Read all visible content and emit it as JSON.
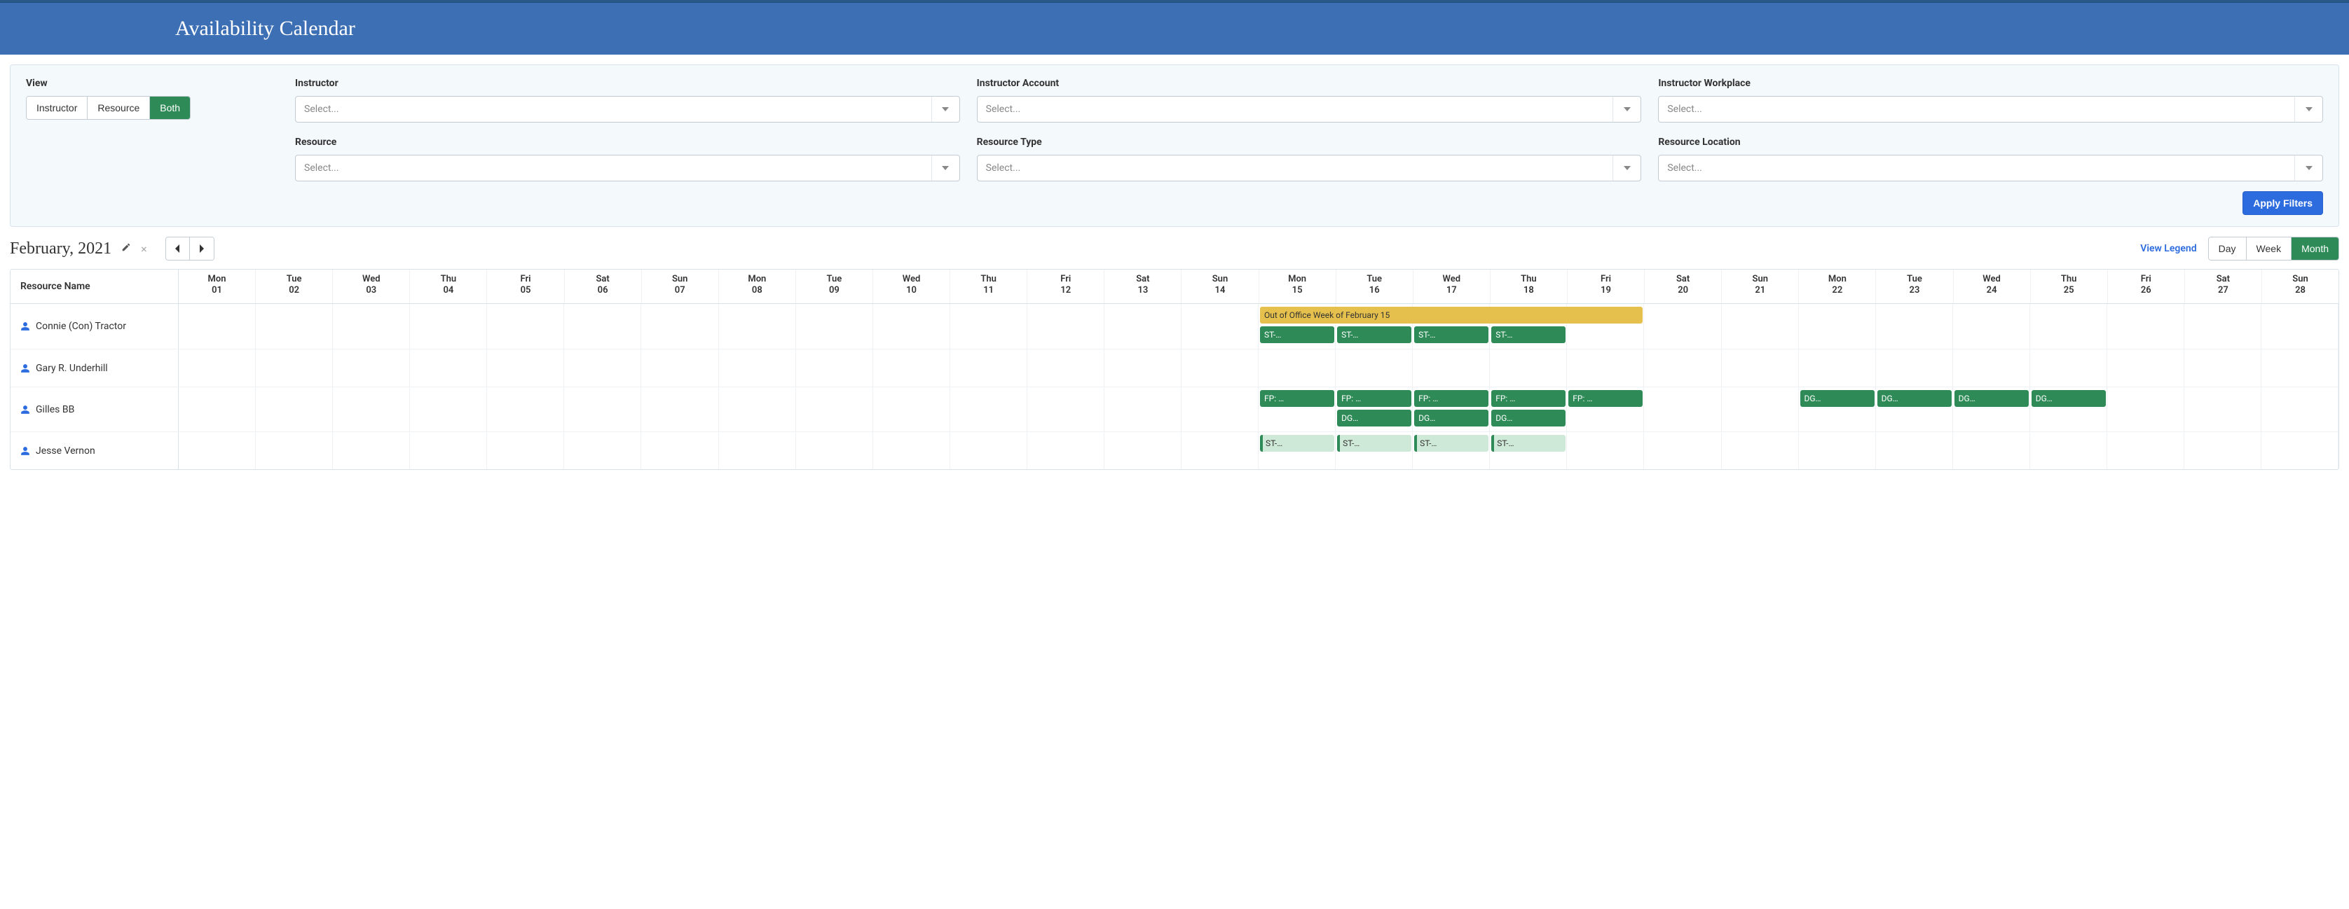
{
  "header": {
    "title": "Availability Calendar"
  },
  "filters": {
    "view_label": "View",
    "view_options": [
      "Instructor",
      "Resource",
      "Both"
    ],
    "view_selected": "Both",
    "selects": [
      {
        "label": "Instructor",
        "value": "Select..."
      },
      {
        "label": "Instructor Account",
        "value": "Select..."
      },
      {
        "label": "Instructor Workplace",
        "value": "Select..."
      },
      {
        "label": "Resource",
        "value": "Select..."
      },
      {
        "label": "Resource Type",
        "value": "Select..."
      },
      {
        "label": "Resource Location",
        "value": "Select..."
      }
    ],
    "apply_label": "Apply Filters"
  },
  "toolbar": {
    "month_title": "February, 2021",
    "view_legend": "View Legend",
    "range_options": [
      "Day",
      "Week",
      "Month"
    ],
    "range_selected": "Month"
  },
  "calendar": {
    "resource_header": "Resource Name",
    "days": [
      {
        "dow": "Mon",
        "num": "01"
      },
      {
        "dow": "Tue",
        "num": "02"
      },
      {
        "dow": "Wed",
        "num": "03"
      },
      {
        "dow": "Thu",
        "num": "04"
      },
      {
        "dow": "Fri",
        "num": "05"
      },
      {
        "dow": "Sat",
        "num": "06"
      },
      {
        "dow": "Sun",
        "num": "07"
      },
      {
        "dow": "Mon",
        "num": "08"
      },
      {
        "dow": "Tue",
        "num": "09"
      },
      {
        "dow": "Wed",
        "num": "10"
      },
      {
        "dow": "Thu",
        "num": "11"
      },
      {
        "dow": "Fri",
        "num": "12"
      },
      {
        "dow": "Sat",
        "num": "13"
      },
      {
        "dow": "Sun",
        "num": "14"
      },
      {
        "dow": "Mon",
        "num": "15"
      },
      {
        "dow": "Tue",
        "num": "16"
      },
      {
        "dow": "Wed",
        "num": "17"
      },
      {
        "dow": "Thu",
        "num": "18"
      },
      {
        "dow": "Fri",
        "num": "19"
      },
      {
        "dow": "Sat",
        "num": "20"
      },
      {
        "dow": "Sun",
        "num": "21"
      },
      {
        "dow": "Mon",
        "num": "22"
      },
      {
        "dow": "Tue",
        "num": "23"
      },
      {
        "dow": "Wed",
        "num": "24"
      },
      {
        "dow": "Thu",
        "num": "25"
      },
      {
        "dow": "Fri",
        "num": "26"
      },
      {
        "dow": "Sat",
        "num": "27"
      },
      {
        "dow": "Sun",
        "num": "28"
      }
    ],
    "resources": [
      {
        "name": "Connie (Con) Tractor",
        "events": [
          {
            "label": "Out of Office Week of February 15",
            "start": 14,
            "span": 5,
            "row": 0,
            "type": "yellow"
          },
          {
            "label": "ST-…",
            "start": 14,
            "span": 1,
            "row": 1,
            "type": "green"
          },
          {
            "label": "ST-…",
            "start": 15,
            "span": 1,
            "row": 1,
            "type": "green"
          },
          {
            "label": "ST-…",
            "start": 16,
            "span": 1,
            "row": 1,
            "type": "green"
          },
          {
            "label": "ST-…",
            "start": 17,
            "span": 1,
            "row": 1,
            "type": "green"
          }
        ]
      },
      {
        "name": "Gary R. Underhill",
        "events": []
      },
      {
        "name": "Gilles BB",
        "events": [
          {
            "label": "FP: …",
            "start": 14,
            "span": 1,
            "row": 0,
            "type": "green"
          },
          {
            "label": "FP: …",
            "start": 15,
            "span": 1,
            "row": 0,
            "type": "green"
          },
          {
            "label": "FP: …",
            "start": 16,
            "span": 1,
            "row": 0,
            "type": "green"
          },
          {
            "label": "FP: …",
            "start": 17,
            "span": 1,
            "row": 0,
            "type": "green"
          },
          {
            "label": "FP: …",
            "start": 18,
            "span": 1,
            "row": 0,
            "type": "green"
          },
          {
            "label": "DG…",
            "start": 15,
            "span": 1,
            "row": 1,
            "type": "green"
          },
          {
            "label": "DG…",
            "start": 16,
            "span": 1,
            "row": 1,
            "type": "green"
          },
          {
            "label": "DG…",
            "start": 17,
            "span": 1,
            "row": 1,
            "type": "green"
          },
          {
            "label": "DG…",
            "start": 21,
            "span": 1,
            "row": 0,
            "type": "green"
          },
          {
            "label": "DG…",
            "start": 22,
            "span": 1,
            "row": 0,
            "type": "green"
          },
          {
            "label": "DG…",
            "start": 23,
            "span": 1,
            "row": 0,
            "type": "green"
          },
          {
            "label": "DG…",
            "start": 24,
            "span": 1,
            "row": 0,
            "type": "green"
          }
        ]
      },
      {
        "name": "Jesse Vernon",
        "events": [
          {
            "label": "ST-…",
            "start": 14,
            "span": 1,
            "row": 0,
            "type": "lightgreen"
          },
          {
            "label": "ST-…",
            "start": 15,
            "span": 1,
            "row": 0,
            "type": "lightgreen"
          },
          {
            "label": "ST-…",
            "start": 16,
            "span": 1,
            "row": 0,
            "type": "lightgreen"
          },
          {
            "label": "ST-…",
            "start": 17,
            "span": 1,
            "row": 0,
            "type": "lightgreen"
          }
        ]
      }
    ]
  }
}
